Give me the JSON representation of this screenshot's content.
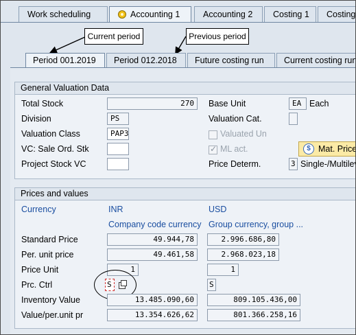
{
  "top_tabs": [
    "Work scheduling",
    "Accounting 1",
    "Accounting 2",
    "Costing 1",
    "Costing"
  ],
  "callouts": {
    "current": "Current period",
    "previous": "Previous period"
  },
  "sub_tabs": [
    "Period 001.2019",
    "Period 012.2018",
    "Future costing run",
    "Current costing run"
  ],
  "general": {
    "title": "General Valuation Data",
    "total_stock_label": "Total Stock",
    "total_stock": "270",
    "base_unit_label": "Base Unit",
    "base_unit": "EA",
    "base_unit_text": "Each",
    "division_label": "Division",
    "division": "PS",
    "valuation_cat_label": "Valuation Cat.",
    "valuation_cat": "",
    "valuation_class_label": "Valuation Class",
    "valuation_class": "PAP3",
    "valuated_un_label": "Valuated Un",
    "vc_sale_label": "VC: Sale Ord. Stk",
    "vc_sale": "",
    "ml_act_label": "ML act.",
    "mat_price_button": "Mat. Price",
    "project_stock_label": "Project Stock VC",
    "project_stock": "",
    "price_determ_label": "Price Determ.",
    "price_determ": "3",
    "price_determ_text": "Single-/Multilevel"
  },
  "prices": {
    "title": "Prices and values",
    "currency_label": "Currency",
    "currency_1": "INR",
    "currency_2": "USD",
    "currency_1_desc": "Company code currency",
    "currency_2_desc": "Group currency, group ...",
    "standard_price_label": "Standard Price",
    "standard_price_1": "49.944,78",
    "standard_price_2": "2.996.686,80",
    "per_unit_price_label": "Per. unit price",
    "per_unit_price_1": "49.461,58",
    "per_unit_price_2": "2.968.023,18",
    "price_unit_label": "Price Unit",
    "price_unit_1": "1",
    "price_unit_2": "1",
    "prc_ctrl_label": "Prc. Ctrl",
    "prc_ctrl_1": "S",
    "prc_ctrl_2": "S",
    "inventory_value_label": "Inventory Value",
    "inventory_value_1": "13.485.090,60",
    "inventory_value_2": "809.105.436,00",
    "value_per_unit_label": "Value/per.unit pr",
    "value_per_unit_1": "13.354.626,62",
    "value_per_unit_2": "801.366.258,16"
  }
}
